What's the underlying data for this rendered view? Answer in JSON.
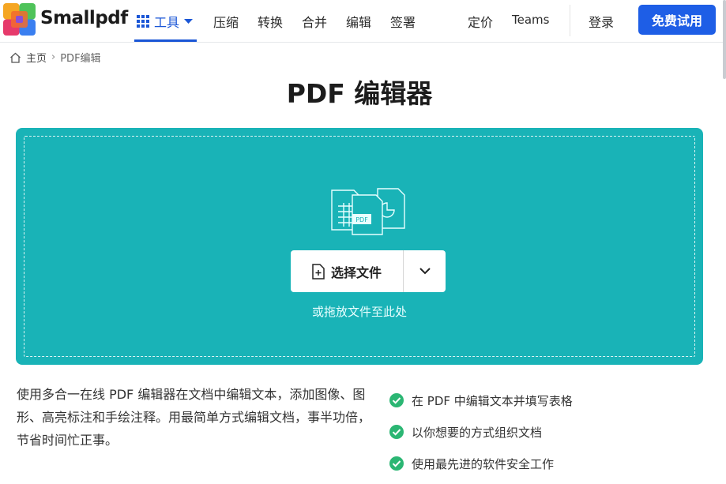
{
  "header": {
    "brand": "Smallpdf",
    "tools_label": "工具",
    "nav": [
      "压缩",
      "转换",
      "合并",
      "编辑",
      "签署"
    ],
    "pricing_label": "定价",
    "teams_label": "Teams",
    "login_label": "登录",
    "cta_label": "免费试用"
  },
  "breadcrumb": {
    "home": "主页",
    "current": "PDF编辑"
  },
  "title": "PDF 编辑器",
  "dropzone": {
    "select_label": "选择文件",
    "hint": "或拖放文件至此处",
    "illustration_badge": "PDF"
  },
  "description": "使用多合一在线 PDF 编辑器在文档中编辑文本，添加图像、图形、高亮标注和手绘注释。用最简单方式编辑文档，事半功倍，节省时间忙正事。",
  "features": [
    "在 PDF 中编辑文本并填写表格",
    "以你想要的方式组织文档",
    "使用最先进的软件安全工作"
  ],
  "colors": {
    "accent": "#1e5ee6",
    "dropzone": "#19b3b7",
    "check": "#2bb673"
  }
}
